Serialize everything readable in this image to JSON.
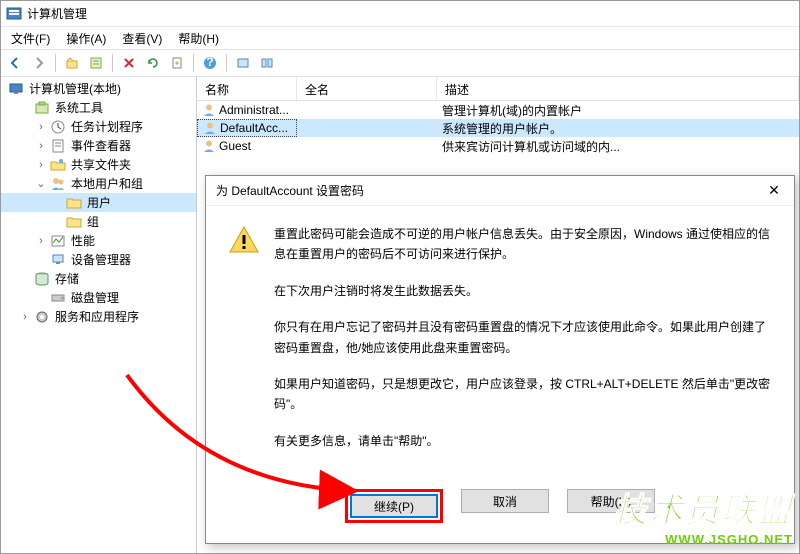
{
  "titlebar": {
    "title": "计算机管理"
  },
  "menubar": {
    "items": [
      "文件(F)",
      "操作(A)",
      "查看(V)",
      "帮助(H)"
    ]
  },
  "tree": {
    "root": "计算机管理(本地)",
    "nodes": [
      {
        "label": "系统工具",
        "level": 1,
        "expanded": true
      },
      {
        "label": "任务计划程序",
        "level": 2,
        "expanded": false,
        "hasChildren": true
      },
      {
        "label": "事件查看器",
        "level": 2,
        "expanded": false,
        "hasChildren": true
      },
      {
        "label": "共享文件夹",
        "level": 2,
        "expanded": false,
        "hasChildren": true
      },
      {
        "label": "本地用户和组",
        "level": 2,
        "expanded": true,
        "hasChildren": true
      },
      {
        "label": "用户",
        "level": 3,
        "selected": true
      },
      {
        "label": "组",
        "level": 3
      },
      {
        "label": "性能",
        "level": 2,
        "expanded": false,
        "hasChildren": true
      },
      {
        "label": "设备管理器",
        "level": 2
      },
      {
        "label": "存储",
        "level": 1,
        "expanded": true
      },
      {
        "label": "磁盘管理",
        "level": 2
      },
      {
        "label": "服务和应用程序",
        "level": 1,
        "expanded": false,
        "hasChildren": true
      }
    ]
  },
  "list": {
    "headers": {
      "name": "名称",
      "fullname": "全名",
      "desc": "描述"
    },
    "rows": [
      {
        "name": "Administrat...",
        "fullname": "",
        "desc": "管理计算机(域)的内置帐户"
      },
      {
        "name": "DefaultAcc...",
        "fullname": "",
        "desc": "系统管理的用户帐户。",
        "selected": true
      },
      {
        "name": "Guest",
        "fullname": "",
        "desc": "供来宾访问计算机或访问域的内..."
      }
    ]
  },
  "dialog": {
    "title": "为 DefaultAccount 设置密码",
    "p1": "重置此密码可能会造成不可逆的用户帐户信息丢失。由于安全原因，Windows 通过使相应的信息在重置用户的密码后不可访问来进行保护。",
    "p2": "在下次用户注销时将发生此数据丢失。",
    "p3": "你只有在用户忘记了密码并且没有密码重置盘的情况下才应该使用此命令。如果此用户创建了密码重置盘，他/她应该使用此盘来重置密码。",
    "p4": "如果用户知道密码，只是想更改它，用户应该登录，按 CTRL+ALT+DELETE 然后单击\"更改密码\"。",
    "p5": "有关更多信息，请单击\"帮助\"。",
    "btn_continue": "继续(P)",
    "btn_cancel": "取消",
    "btn_help": "帮助(H)"
  },
  "watermark": {
    "text": "技术员联盟",
    "url": "WWW.JSGHO.NET"
  }
}
